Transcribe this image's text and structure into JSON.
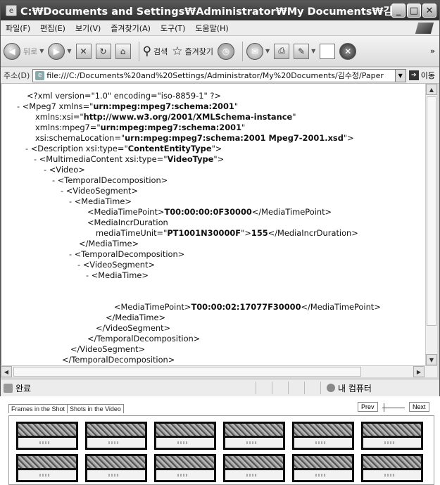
{
  "window": {
    "title": "C:₩Documents and Settings₩Administrator₩My Documents₩김수정₩Paper..."
  },
  "menubar": {
    "items": [
      "파일(F)",
      "편집(E)",
      "보기(V)",
      "즐겨찾기(A)",
      "도구(T)",
      "도움말(H)"
    ]
  },
  "toolbar": {
    "back_label": "뒤로",
    "search_label": "검색",
    "favorites_label": "즐겨찾기"
  },
  "address": {
    "label": "주소(D)",
    "url": "file:///C:/Documents%20and%20Settings/Administrator/My%20Documents/김수정/Paper",
    "go_label": "이동"
  },
  "xml": {
    "l01_a": "<?xml version=\"1.0\" encoding=\"iso-8859-1\" ?>",
    "l02_minus": "-",
    "l02_a": "<Mpeg7 xmlns=\"",
    "l02_b": "urn:mpeg:mpeg7:schema:2001",
    "l02_c": "\"",
    "l03_a": "xmlns:xsi=\"",
    "l03_b": "http://www.w3.org/2001/XMLSchema-instance",
    "l03_c": "\"",
    "l04_a": "xmlns:mpeg7=\"",
    "l04_b": "urn:mpeg:mpeg7:schema:2001",
    "l04_c": "\"",
    "l05_a": "xsi:schemaLocation=\"",
    "l05_b": "urn:mpeg:mpeg7:schema:2001 Mpeg7-2001.xsd",
    "l05_c": "\">",
    "l06_minus": "-",
    "l06_a": "<Description xsi:type=\"",
    "l06_b": "ContentEntityType",
    "l06_c": "\">",
    "l07_minus": "-",
    "l07_a": "<MultimediaContent xsi:type=\"",
    "l07_b": "VideoType",
    "l07_c": "\">",
    "l08_minus": "-",
    "l08_a": "<Video>",
    "l09_minus": "-",
    "l09_a": "<TemporalDecomposition>",
    "l10_minus": "-",
    "l10_a": "<VideoSegment>",
    "l11_minus": "-",
    "l11_a": "<MediaTime>",
    "l12_a": "<MediaTimePoint>",
    "l12_b": "T00:00:00:0F30000",
    "l12_c": "</MediaTimePoint>",
    "l13_a": "<MediaIncrDuration",
    "l14_a": "mediaTimeUnit=\"",
    "l14_b": "PT1001N30000F",
    "l14_c": "\">",
    "l14_d": "155",
    "l14_e": "</MediaIncrDuration>",
    "l15_a": "</MediaTime>",
    "l16_minus": "-",
    "l16_a": "<TemporalDecomposition>",
    "l17_minus": "-",
    "l17_a": "<VideoSegment>",
    "l18_minus": "-",
    "l18_a": "<MediaTime>",
    "l19_a": "<MediaTimePoint>",
    "l19_b": "T00:00:02:17077F30000",
    "l19_c": "</MediaTimePoint>",
    "l20_a": "</MediaTime>",
    "l21_a": "</VideoSegment>",
    "l22_a": "</TemporalDecomposition>",
    "l23_a": "</VideoSegment>",
    "l24_a": "</TemporalDecomposition>"
  },
  "statusbar": {
    "status_text": "완료",
    "zone_text": "내 컴퓨터"
  },
  "frames_panel": {
    "tabs": [
      "Frames in the Shot",
      "Shots in the Video"
    ],
    "prev_label": "Prev",
    "next_label": "Next"
  }
}
